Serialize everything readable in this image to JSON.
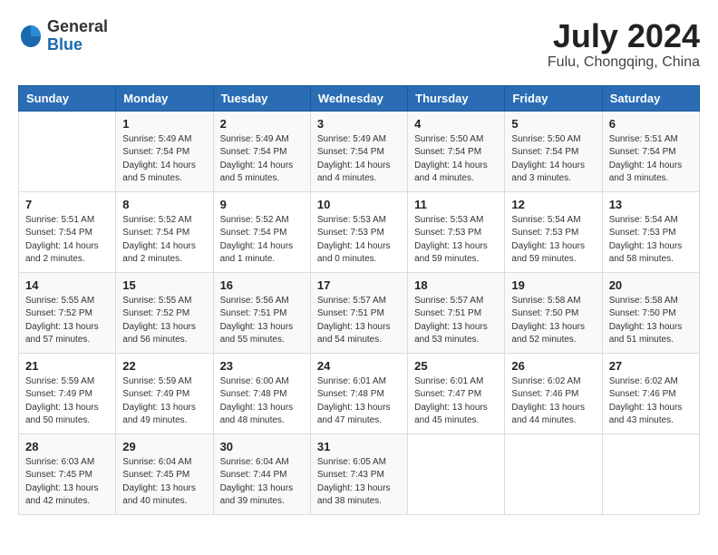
{
  "logo": {
    "general": "General",
    "blue": "Blue"
  },
  "title": {
    "month_year": "July 2024",
    "location": "Fulu, Chongqing, China"
  },
  "headers": [
    "Sunday",
    "Monday",
    "Tuesday",
    "Wednesday",
    "Thursday",
    "Friday",
    "Saturday"
  ],
  "weeks": [
    [
      {
        "day": "",
        "content": ""
      },
      {
        "day": "1",
        "content": "Sunrise: 5:49 AM\nSunset: 7:54 PM\nDaylight: 14 hours\nand 5 minutes."
      },
      {
        "day": "2",
        "content": "Sunrise: 5:49 AM\nSunset: 7:54 PM\nDaylight: 14 hours\nand 5 minutes."
      },
      {
        "day": "3",
        "content": "Sunrise: 5:49 AM\nSunset: 7:54 PM\nDaylight: 14 hours\nand 4 minutes."
      },
      {
        "day": "4",
        "content": "Sunrise: 5:50 AM\nSunset: 7:54 PM\nDaylight: 14 hours\nand 4 minutes."
      },
      {
        "day": "5",
        "content": "Sunrise: 5:50 AM\nSunset: 7:54 PM\nDaylight: 14 hours\nand 3 minutes."
      },
      {
        "day": "6",
        "content": "Sunrise: 5:51 AM\nSunset: 7:54 PM\nDaylight: 14 hours\nand 3 minutes."
      }
    ],
    [
      {
        "day": "7",
        "content": "Sunrise: 5:51 AM\nSunset: 7:54 PM\nDaylight: 14 hours\nand 2 minutes."
      },
      {
        "day": "8",
        "content": "Sunrise: 5:52 AM\nSunset: 7:54 PM\nDaylight: 14 hours\nand 2 minutes."
      },
      {
        "day": "9",
        "content": "Sunrise: 5:52 AM\nSunset: 7:54 PM\nDaylight: 14 hours\nand 1 minute."
      },
      {
        "day": "10",
        "content": "Sunrise: 5:53 AM\nSunset: 7:53 PM\nDaylight: 14 hours\nand 0 minutes."
      },
      {
        "day": "11",
        "content": "Sunrise: 5:53 AM\nSunset: 7:53 PM\nDaylight: 13 hours\nand 59 minutes."
      },
      {
        "day": "12",
        "content": "Sunrise: 5:54 AM\nSunset: 7:53 PM\nDaylight: 13 hours\nand 59 minutes."
      },
      {
        "day": "13",
        "content": "Sunrise: 5:54 AM\nSunset: 7:53 PM\nDaylight: 13 hours\nand 58 minutes."
      }
    ],
    [
      {
        "day": "14",
        "content": "Sunrise: 5:55 AM\nSunset: 7:52 PM\nDaylight: 13 hours\nand 57 minutes."
      },
      {
        "day": "15",
        "content": "Sunrise: 5:55 AM\nSunset: 7:52 PM\nDaylight: 13 hours\nand 56 minutes."
      },
      {
        "day": "16",
        "content": "Sunrise: 5:56 AM\nSunset: 7:51 PM\nDaylight: 13 hours\nand 55 minutes."
      },
      {
        "day": "17",
        "content": "Sunrise: 5:57 AM\nSunset: 7:51 PM\nDaylight: 13 hours\nand 54 minutes."
      },
      {
        "day": "18",
        "content": "Sunrise: 5:57 AM\nSunset: 7:51 PM\nDaylight: 13 hours\nand 53 minutes."
      },
      {
        "day": "19",
        "content": "Sunrise: 5:58 AM\nSunset: 7:50 PM\nDaylight: 13 hours\nand 52 minutes."
      },
      {
        "day": "20",
        "content": "Sunrise: 5:58 AM\nSunset: 7:50 PM\nDaylight: 13 hours\nand 51 minutes."
      }
    ],
    [
      {
        "day": "21",
        "content": "Sunrise: 5:59 AM\nSunset: 7:49 PM\nDaylight: 13 hours\nand 50 minutes."
      },
      {
        "day": "22",
        "content": "Sunrise: 5:59 AM\nSunset: 7:49 PM\nDaylight: 13 hours\nand 49 minutes."
      },
      {
        "day": "23",
        "content": "Sunrise: 6:00 AM\nSunset: 7:48 PM\nDaylight: 13 hours\nand 48 minutes."
      },
      {
        "day": "24",
        "content": "Sunrise: 6:01 AM\nSunset: 7:48 PM\nDaylight: 13 hours\nand 47 minutes."
      },
      {
        "day": "25",
        "content": "Sunrise: 6:01 AM\nSunset: 7:47 PM\nDaylight: 13 hours\nand 45 minutes."
      },
      {
        "day": "26",
        "content": "Sunrise: 6:02 AM\nSunset: 7:46 PM\nDaylight: 13 hours\nand 44 minutes."
      },
      {
        "day": "27",
        "content": "Sunrise: 6:02 AM\nSunset: 7:46 PM\nDaylight: 13 hours\nand 43 minutes."
      }
    ],
    [
      {
        "day": "28",
        "content": "Sunrise: 6:03 AM\nSunset: 7:45 PM\nDaylight: 13 hours\nand 42 minutes."
      },
      {
        "day": "29",
        "content": "Sunrise: 6:04 AM\nSunset: 7:45 PM\nDaylight: 13 hours\nand 40 minutes."
      },
      {
        "day": "30",
        "content": "Sunrise: 6:04 AM\nSunset: 7:44 PM\nDaylight: 13 hours\nand 39 minutes."
      },
      {
        "day": "31",
        "content": "Sunrise: 6:05 AM\nSunset: 7:43 PM\nDaylight: 13 hours\nand 38 minutes."
      },
      {
        "day": "",
        "content": ""
      },
      {
        "day": "",
        "content": ""
      },
      {
        "day": "",
        "content": ""
      }
    ]
  ]
}
